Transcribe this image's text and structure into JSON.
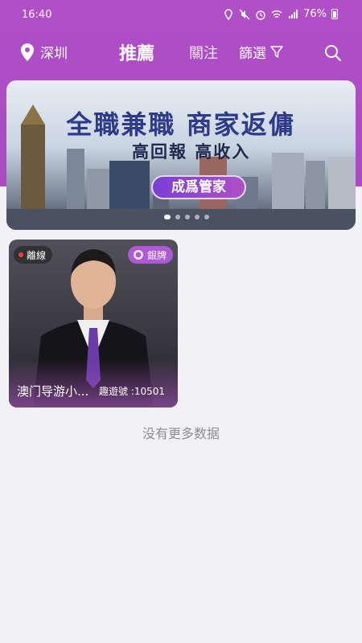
{
  "status_bar": {
    "time": "16:40",
    "battery": "76%"
  },
  "nav": {
    "location": "深圳",
    "tabs": [
      {
        "label": "推薦",
        "active": true
      },
      {
        "label": "關注",
        "active": false
      }
    ],
    "filter_label": "篩選"
  },
  "banner": {
    "headline": "全職兼職 商家返傭",
    "subline": "高回報 高收入",
    "cta": "成爲管家",
    "slide_count": 5,
    "active_slide": 1
  },
  "cards": [
    {
      "status": "離線",
      "rank": "銀牌",
      "name": "澳门导游小...",
      "uid": "趣遊號 :10501"
    }
  ],
  "footer": {
    "no_more": "没有更多数据"
  },
  "colors": {
    "primary": "#b04fc6",
    "background": "#f2f1f6",
    "offline_dot": "#ff3b3b",
    "rank_badge": "#b059d6"
  }
}
